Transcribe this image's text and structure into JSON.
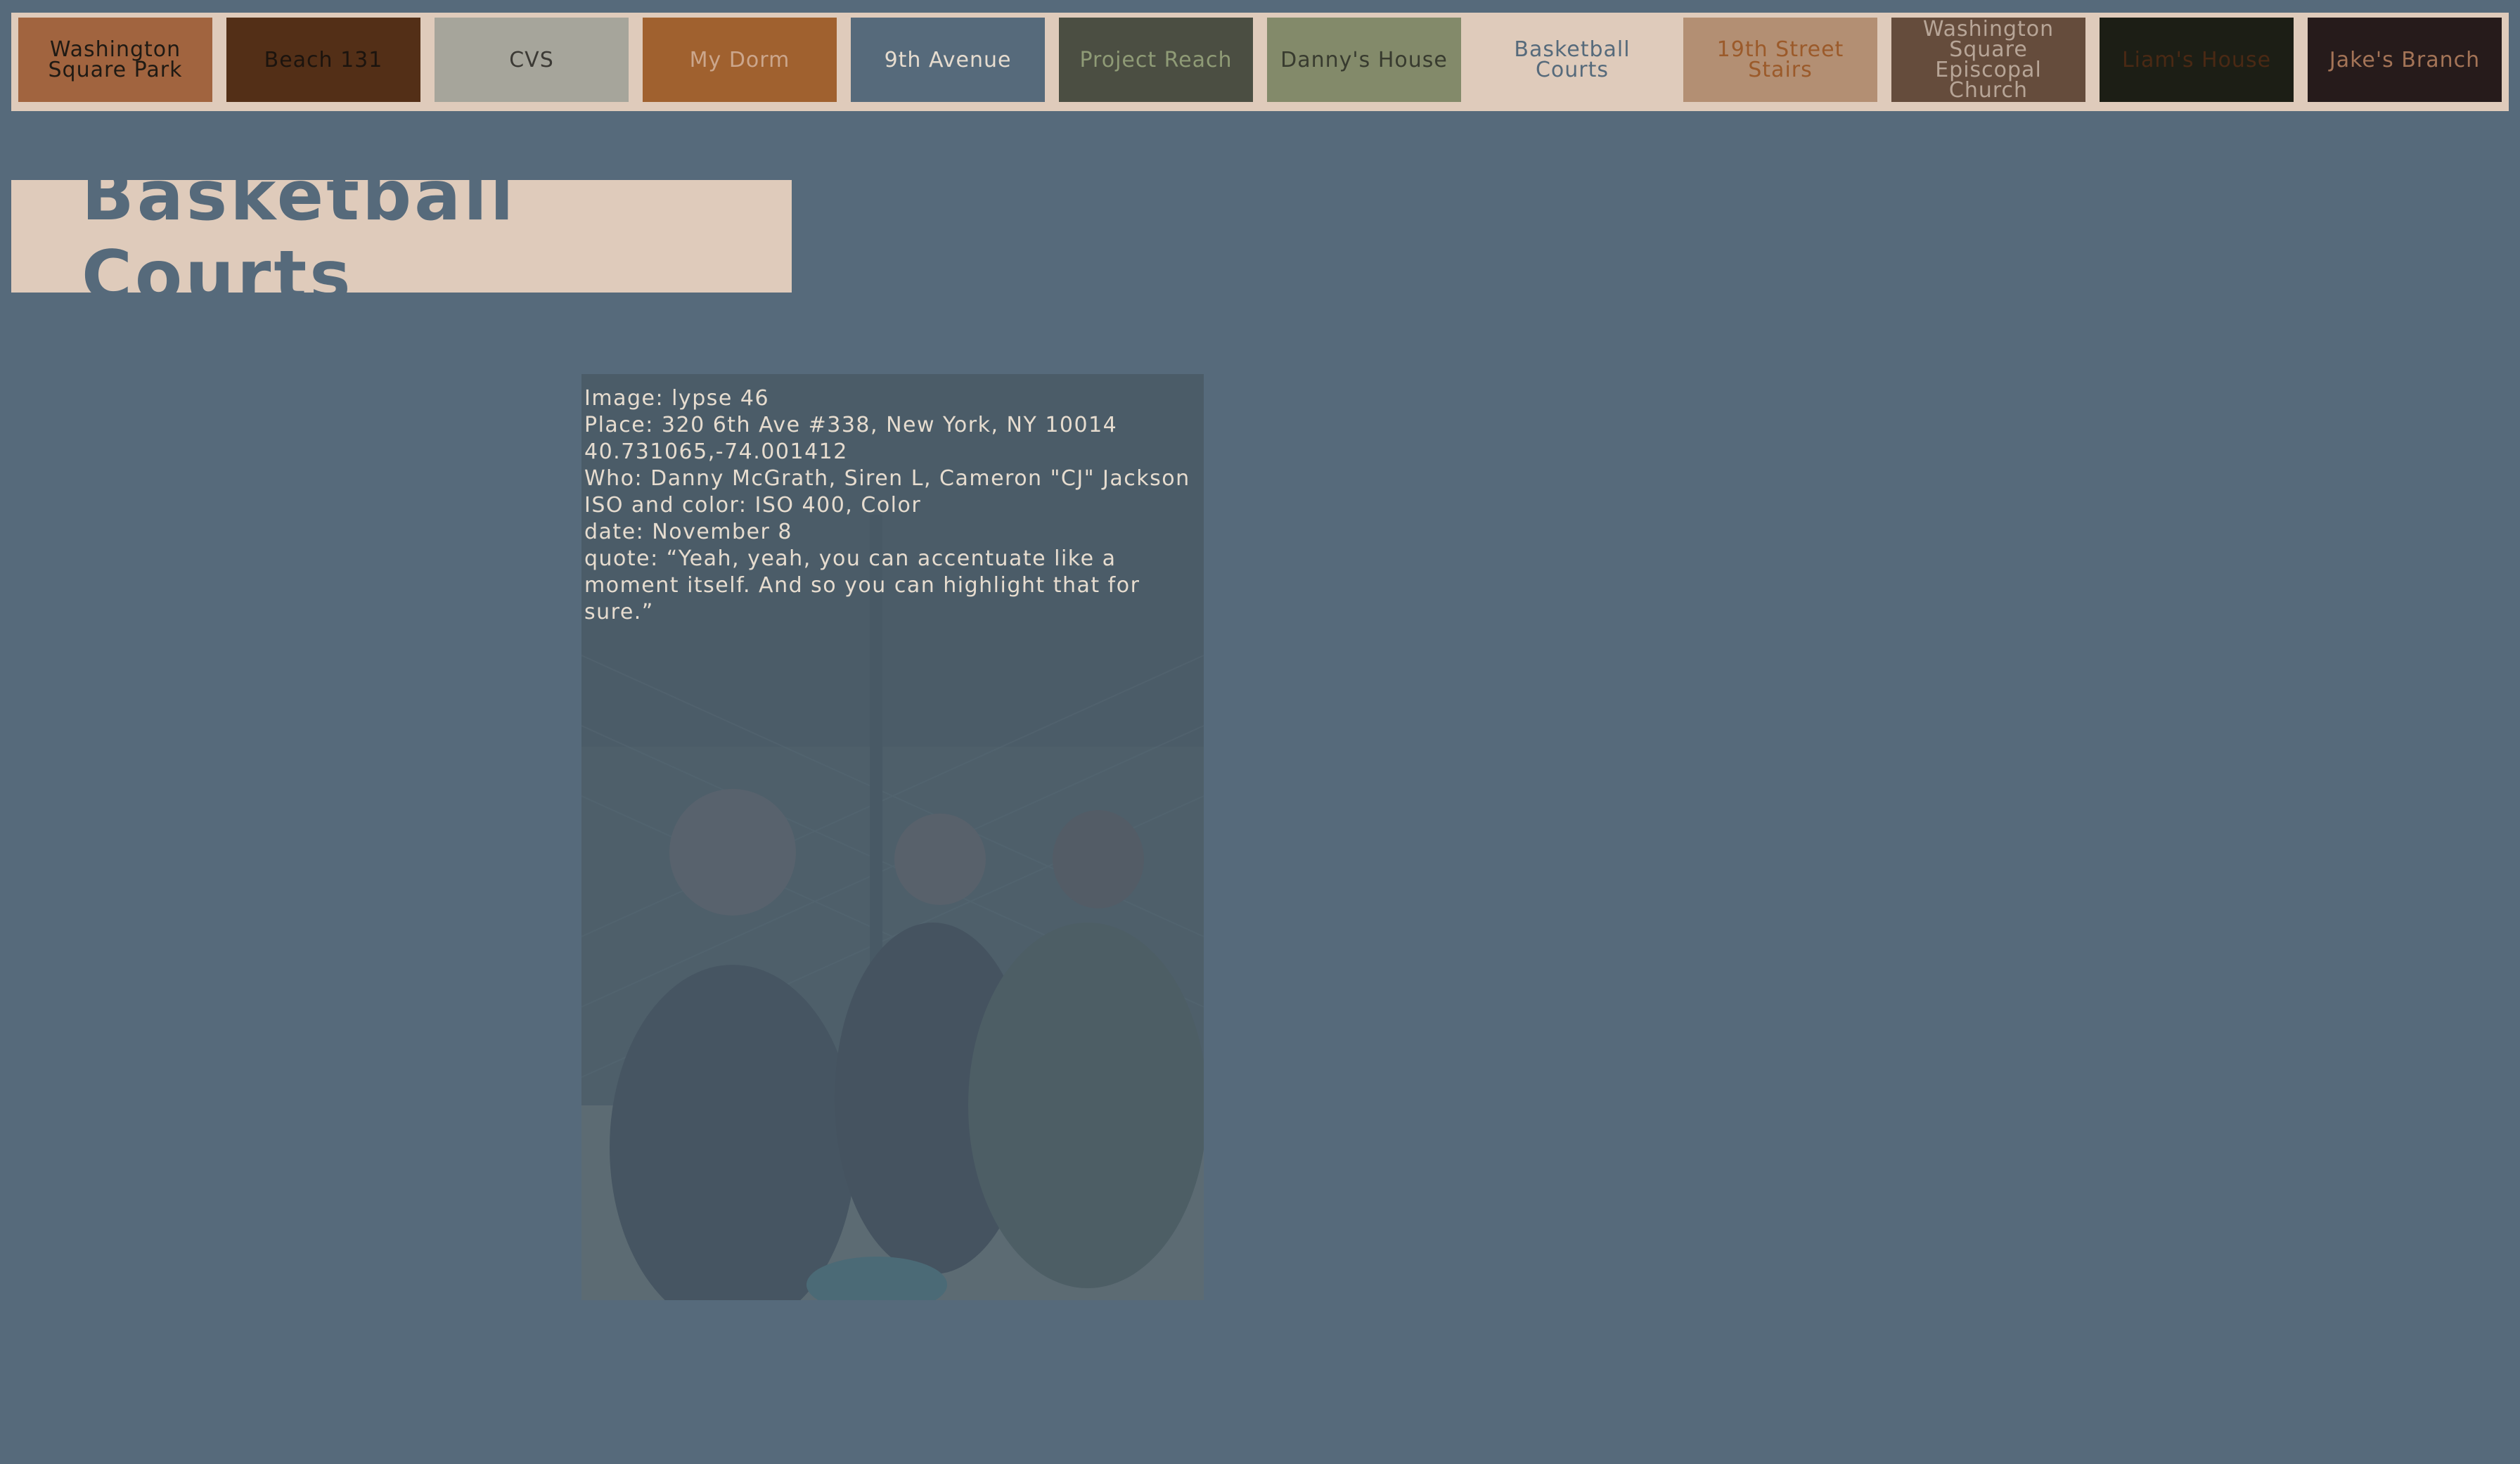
{
  "nav": {
    "tabs": [
      {
        "label": "Washington\nSquare Park",
        "bg": "#a1643f",
        "fg": "#1f1a14"
      },
      {
        "label": "Beach 131",
        "bg": "#532f17",
        "fg": "#1c140e"
      },
      {
        "label": "CVS",
        "bg": "#a6a59b",
        "fg": "#3c3a35"
      },
      {
        "label": "My Dorm",
        "bg": "#a0612f",
        "fg": "#cba68c"
      },
      {
        "label": "9th Avenue",
        "bg": "#566a7b",
        "fg": "#e6dccf"
      },
      {
        "label": "Project Reach",
        "bg": "#4b4e42",
        "fg": "#8f9b76"
      },
      {
        "label": "Danny's House",
        "bg": "#838a6a",
        "fg": "#383b2f"
      },
      {
        "label": "Basketball Courts",
        "bg": "#dfcbbb",
        "fg": "#566a7b",
        "active": true
      },
      {
        "label": "19th Street\nStairs",
        "bg": "#b38f73",
        "fg": "#9b5a2a"
      },
      {
        "label": "Washington\nSquare Episcopal\nChurch",
        "bg": "#654c3c",
        "fg": "#b7a597"
      },
      {
        "label": "Liam's House",
        "bg": "#1c1e15",
        "fg": "#4a2914"
      },
      {
        "label": "Jake's Branch",
        "bg": "#261b1b",
        "fg": "#a47457"
      }
    ]
  },
  "page": {
    "title": "Basketball Courts"
  },
  "photo": {
    "description_icon": "photo-image",
    "caption": {
      "image": "Image: lypse 46",
      "place": "Place: 320 6th Ave #338, New York, NY 10014",
      "coords": "40.731065,-74.001412",
      "who": "Who: Danny McGrath, Siren L, Cameron \"CJ\" Jackson",
      "iso": "ISO and color: ISO 400, Color",
      "date": "date: November 8",
      "quote": "quote: “Yeah, yeah, you can accentuate like a moment itself. And so you can highlight that for sure.”"
    }
  }
}
